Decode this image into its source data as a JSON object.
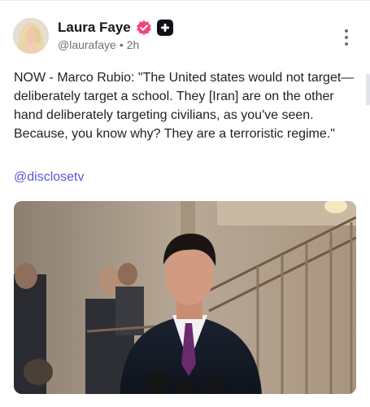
{
  "post": {
    "author_name": "Laura Faye",
    "handle": "@laurafaye",
    "separator": "•",
    "time": "2h",
    "text": "NOW - Marco Rubio: \"The United states would not target—deliberately target a school. They [Iran] are on the other hand deliberately targeting civilians, as you've seen. Because, you know why? They are a terroristic regime.\"",
    "mention": "@disclosetv"
  },
  "icons": {
    "verified": "verified-badge-icon",
    "plus": "plus-badge-icon",
    "more": "more-vertical-icon"
  },
  "colors": {
    "verified_badge": "#f0457a",
    "link": "#5a57d6",
    "secondary_text": "#6f6f7b"
  }
}
